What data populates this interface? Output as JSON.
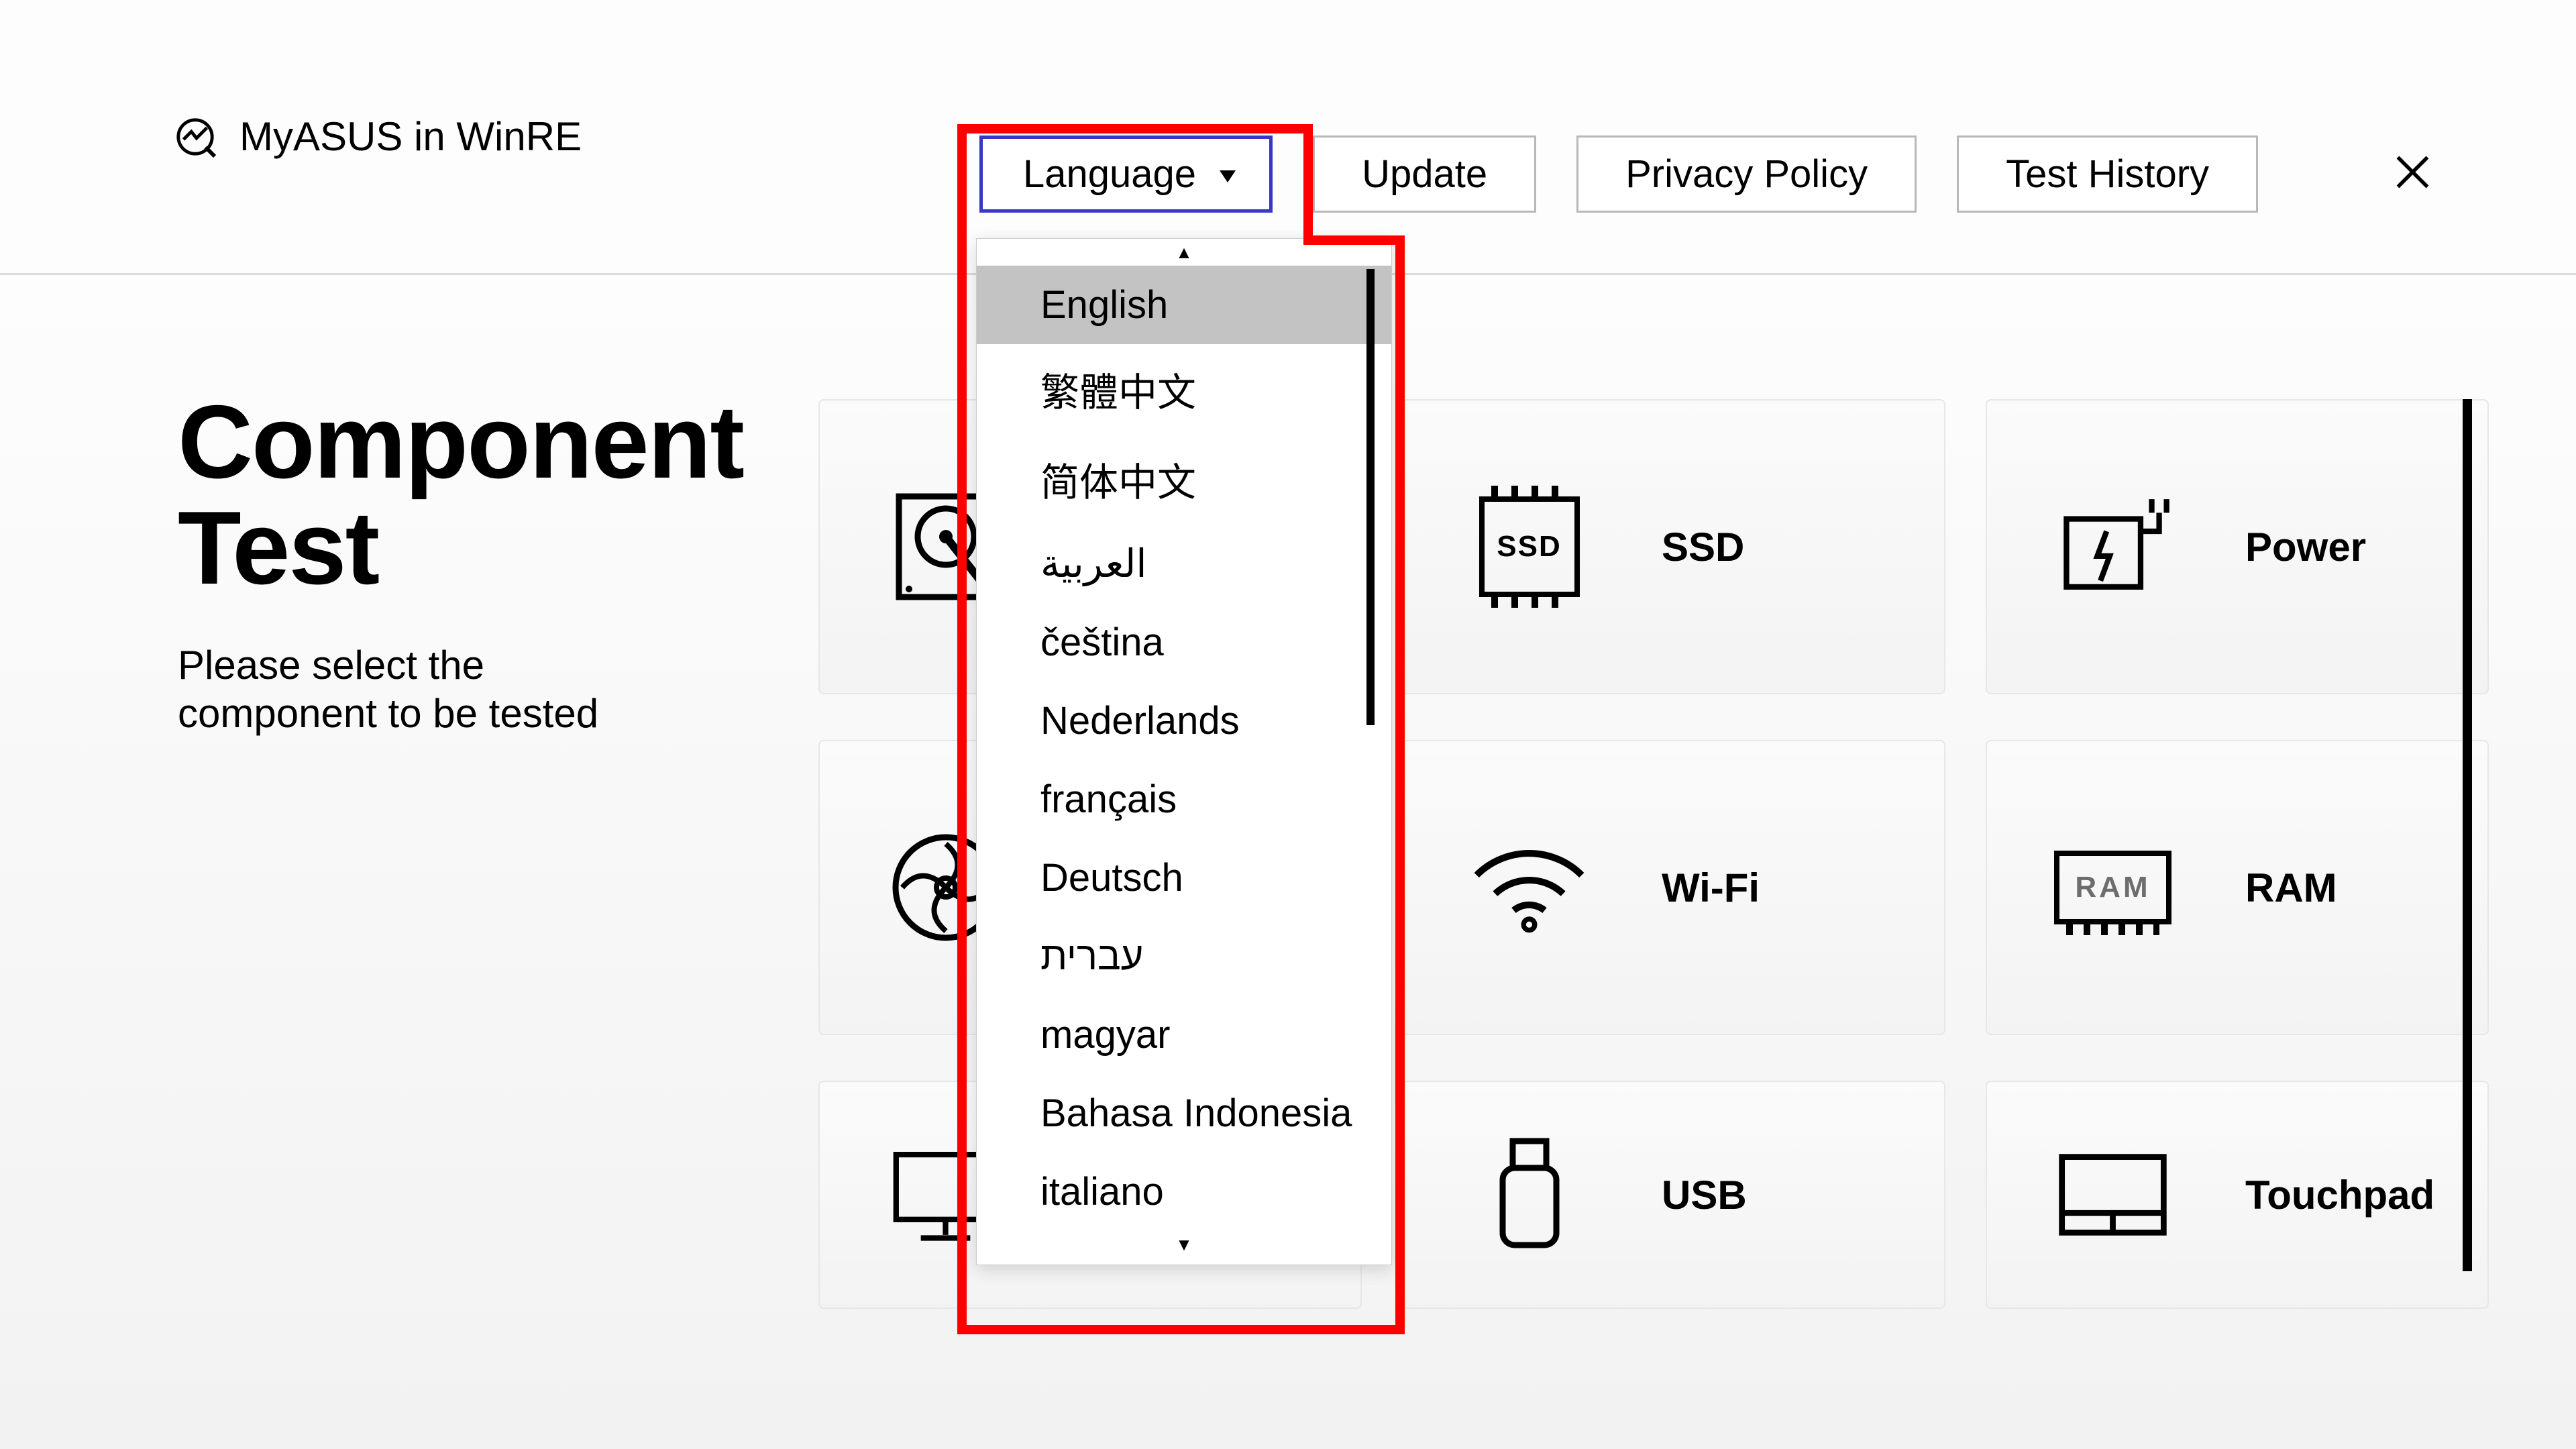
{
  "header": {
    "title": "MyASUS in WinRE",
    "language_label": "Language",
    "update_label": "Update",
    "privacy_label": "Privacy Policy",
    "history_label": "Test History"
  },
  "dropdown": {
    "selected_index": 0,
    "items": [
      "English",
      "繁體中文",
      "简体中文",
      "العربية",
      "čeština",
      "Nederlands",
      "français",
      "Deutsch",
      "עברית",
      "magyar",
      "Bahasa Indonesia",
      "italiano"
    ]
  },
  "main": {
    "title_line1": "Component",
    "title_line2": "Test",
    "subtitle": "Please select the component to be tested"
  },
  "components": {
    "hdd": "",
    "ssd": "SSD",
    "power": "Power",
    "fan": "",
    "wifi": "Wi-Fi",
    "ram": "RAM",
    "display": "",
    "usb": "USB",
    "touchpad": "Touchpad"
  },
  "icons": {
    "ssd_text": "SSD",
    "ram_text": "RAM"
  }
}
